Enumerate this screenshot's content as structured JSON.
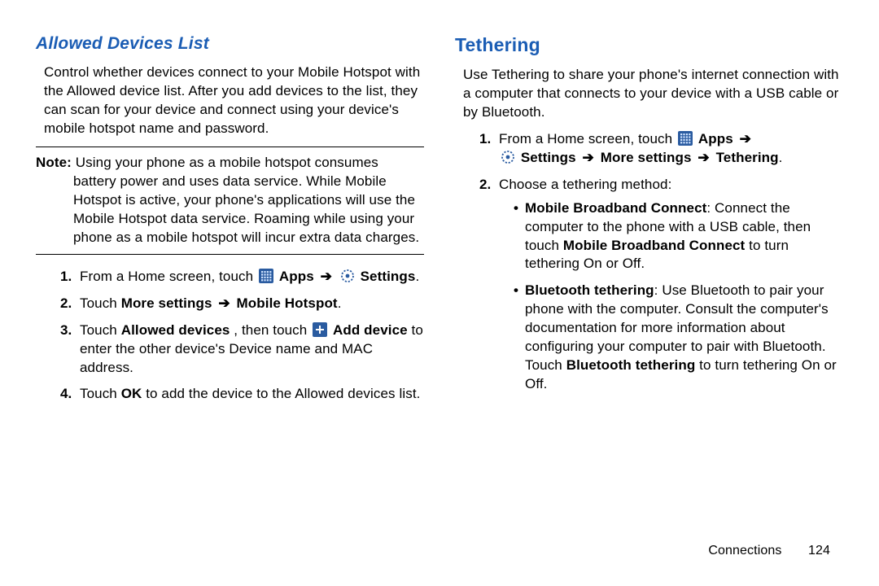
{
  "left": {
    "heading": "Allowed Devices List",
    "intro": "Control whether devices connect to your Mobile Hotspot with the Allowed device list. After you add devices to the list, they can scan for your device and connect using your device's mobile hotspot name and password.",
    "note_label": "Note:",
    "note_body": "Using your phone as a mobile hotspot consumes battery power and uses data service. While Mobile Hotspot is active, your phone's applications will use the Mobile Hotspot data service. Roaming while using your phone as a mobile hotspot will incur extra data charges.",
    "steps": {
      "s1_pre": "From a Home screen, touch ",
      "s1_apps": "Apps",
      "s1_settings": "Settings",
      "s1_end": ".",
      "s2_pre": "Touch ",
      "s2_moresettings": "More settings",
      "s2_hotspot": "Mobile Hotspot",
      "s2_end": ".",
      "s3_pre": "Touch ",
      "s3_allowed": "Allowed devices",
      "s3_mid": ", then touch ",
      "s3_add": "Add device",
      "s3_rest": " to enter the other device's Device name and MAC address.",
      "s4_pre": "Touch ",
      "s4_ok": "OK",
      "s4_rest": " to add the device to the Allowed devices list."
    }
  },
  "right": {
    "heading": "Tethering",
    "intro": "Use Tethering to share your phone's internet connection with a computer that connects to your device with a USB cable or by Bluetooth.",
    "steps": {
      "s1_pre": "From a Home screen, touch ",
      "s1_apps": "Apps",
      "s1_line2_settings": "Settings",
      "s1_line2_more": "More settings",
      "s1_line2_teth": "Tethering",
      "s1_end": ".",
      "s2": "Choose a tethering method:",
      "b1_label": "Mobile Broadband Connect",
      "b1_mid": ": Connect the computer to the phone with a USB cable, then touch ",
      "b1_bold2": "Mobile Broadband Connect",
      "b1_rest": " to turn tethering On or Off.",
      "b2_label": "Bluetooth tethering",
      "b2_mid": ": Use Bluetooth to pair your phone with the computer. Consult the computer's documentation for more information about configuring your computer to pair with Bluetooth. Touch ",
      "b2_bold2": "Bluetooth tethering",
      "b2_rest": " to turn tethering On or Off."
    }
  },
  "footer": {
    "section": "Connections",
    "page": "124"
  },
  "arrow": "➔"
}
